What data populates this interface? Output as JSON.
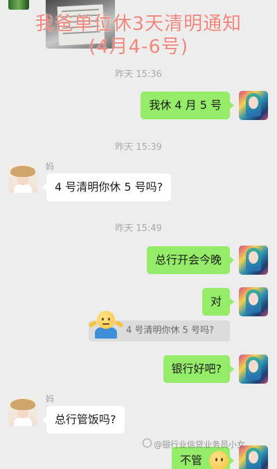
{
  "headline": {
    "line1": "我爸单位休3天清明通知",
    "line2": "(4月4-6号)"
  },
  "messages": [
    {
      "time": "昨天 15:36",
      "from": "me",
      "text": "我休 4 月 5 号"
    },
    {
      "time": "昨天 15:39",
      "from": "妈",
      "text": "4 号清明你休 5 号吗?"
    },
    {
      "time": "昨天 15:49",
      "from": "me",
      "text": "总行开会今晚"
    },
    {
      "from": "me",
      "text": "对"
    },
    {
      "quote": "4 号清明你休 5 号吗?"
    },
    {
      "from": "me",
      "text": "银行好吧?"
    },
    {
      "from": "妈",
      "text": "总行管饭吗?"
    },
    {
      "from": "me",
      "text": "不管"
    }
  ],
  "watermark": "@银行业信贷业务员小女",
  "colors": {
    "background": "#ededed",
    "my_bubble": "#95ec69",
    "their_bubble": "#ffffff",
    "headline": "#f0867b",
    "timestamp": "#a9a9a9"
  }
}
